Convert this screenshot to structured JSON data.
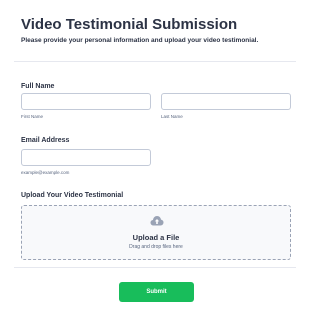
{
  "form": {
    "title": "Video Testimonial Submission",
    "subtitle": "Please provide your personal information and upload your video testimonial.",
    "full_name": {
      "label": "Full Name",
      "first_name_value": "",
      "first_name_sublabel": "First Name",
      "last_name_value": "",
      "last_name_sublabel": "Last Name"
    },
    "email": {
      "label": "Email Address",
      "value": "",
      "sublabel": "example@example.com"
    },
    "upload": {
      "label": "Upload Your Video Testimonial",
      "title": "Upload a File",
      "hint": "Drag and drop files here",
      "icon": "cloud-upload-icon"
    },
    "submit_label": "Submit",
    "colors": {
      "accent": "#18bd5b",
      "text": "#2c3345",
      "border": "#c3cad8"
    }
  }
}
